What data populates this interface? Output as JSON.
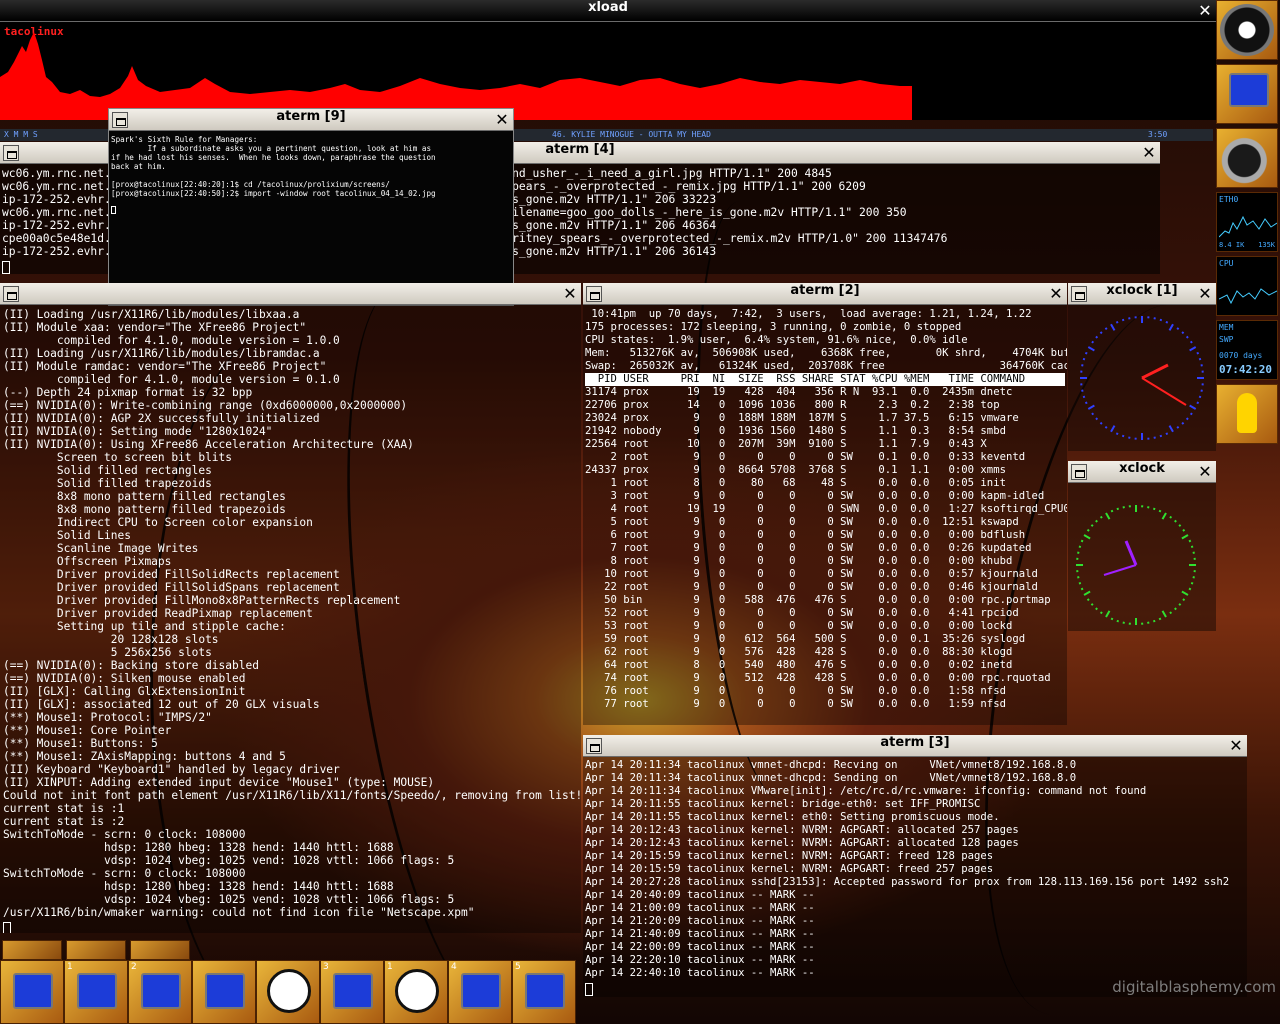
{
  "xload": {
    "title": "xload",
    "host": "tacolinux"
  },
  "xmms": {
    "logo": "X M M S",
    "track": "46. KYLIE MINOGUE - OUTTA MY HEAD",
    "time": "3:50"
  },
  "aterm9": {
    "title": "aterm  [9]",
    "lines": [
      "Spark's Sixth Rule for Managers:",
      "        If a subordinate asks you a pertinent question, look at him as",
      "if he had lost his senses.  When he looks down, paraphrase the question",
      "back at him.",
      "",
      "[prox@tacolinux[22:40:20]:1$ cd /tacolinux/prolixium/screens/",
      "[prox@tacolinux[22:40:50]:2$ import -window root tacolinux_04_14_02.jpg"
    ]
  },
  "aterm4": {
    "title": "aterm  [4]",
    "lines": [
      "wc06.ym.rnc.net.ca                                                p_diddy_and_usher_-_i_need_a_girl.jpg HTTP/1.1\" 200 4845",
      "wc06.ym.rnc.net.ca                                                britney_spears_-_overprotected_-_remix.jpg HTTP/1.1\" 200 6209",
      "ip-172-252.evhr.ne                                                _-_here_is_gone.m2v HTTP/1.1\" 206 33223",
      "wc06.ym.rnc.net.ca                                                deo.php?filename=goo_goo_dolls_-_here_is_gone.m2v HTTP/1.1\" 200 350",
      "ip-172-252.evhr.ne                                                _-_here_is_gone.m2v HTTP/1.1\" 206 46364",
      "cpe00a0c5e48e1d.cp                                                /videos/britney_spears_-_overprotected_-_remix.m2v HTTP/1.0\" 200 11347476",
      "ip-172-252.evhr.ne                                                _-_here_is_gone.m2v HTTP/1.1\" 206 36143"
    ]
  },
  "atermLeft": {
    "lines": [
      "(II) Loading /usr/X11R6/lib/modules/libxaa.a",
      "(II) Module xaa: vendor=\"The XFree86 Project\"",
      "        compiled for 4.1.0, module version = 1.0.0",
      "(II) Loading /usr/X11R6/lib/modules/libramdac.a",
      "(II) Module ramdac: vendor=\"The XFree86 Project\"",
      "        compiled for 4.1.0, module version = 0.1.0",
      "(--) Depth 24 pixmap format is 32 bpp",
      "(==) NVIDIA(0): Write-combining range (0xd6000000,0x2000000)",
      "(II) NVIDIA(0): AGP 2X successfully initialized",
      "(II) NVIDIA(0): Setting mode \"1280x1024\"",
      "(II) NVIDIA(0): Using XFree86 Acceleration Architecture (XAA)",
      "        Screen to screen bit blits",
      "        Solid filled rectangles",
      "        Solid filled trapezoids",
      "        8x8 mono pattern filled rectangles",
      "        8x8 mono pattern filled trapezoids",
      "        Indirect CPU to Screen color expansion",
      "        Solid Lines",
      "        Scanline Image Writes",
      "        Offscreen Pixmaps",
      "        Driver provided FillSolidRects replacement",
      "        Driver provided FillSolidSpans replacement",
      "        Driver provided FillMono8x8PatternRects replacement",
      "        Driver provided ReadPixmap replacement",
      "        Setting up tile and stipple cache:",
      "                20 128x128 slots",
      "                5 256x256 slots",
      "(==) NVIDIA(0): Backing store disabled",
      "(==) NVIDIA(0): Silken mouse enabled",
      "(II) [GLX]: Calling GlxExtensionInit",
      "(II) [GLX]: associated 12 out of 20 GLX visuals",
      "(**) Mouse1: Protocol: \"IMPS/2\"",
      "(**) Mouse1: Core Pointer",
      "(**) Mouse1: Buttons: 5",
      "(**) Mouse1: ZAxisMapping: buttons 4 and 5",
      "(II) Keyboard \"Keyboard1\" handled by legacy driver",
      "(II) XINPUT: Adding extended input device \"Mouse1\" (type: MOUSE)",
      "Could not init font path element /usr/X11R6/lib/X11/fonts/Speedo/, removing from list!",
      "current stat is :1",
      "current stat is :2",
      "SwitchToMode - scrn: 0 clock: 108000",
      "               hdsp: 1280 hbeg: 1328 hend: 1440 httl: 1688",
      "               vdsp: 1024 vbeg: 1025 vend: 1028 vttl: 1066 flags: 5",
      "SwitchToMode - scrn: 0 clock: 108000",
      "               hdsp: 1280 hbeg: 1328 hend: 1440 httl: 1688",
      "               vdsp: 1024 vbeg: 1025 vend: 1028 vttl: 1066 flags: 5",
      "/usr/X11R6/bin/wmaker warning: could not find icon file \"Netscape.xpm\""
    ]
  },
  "aterm2": {
    "title": "aterm  [2]",
    "header": [
      " 10:41pm  up 70 days,  7:42,  3 users,  load average: 1.21, 1.24, 1.22",
      "175 processes: 172 sleeping, 3 running, 0 zombie, 0 stopped",
      "CPU states:  1.9% user,  6.4% system, 91.6% nice,  0.0% idle",
      "Mem:   513276K av,  506908K used,    6368K free,       0K shrd,    4704K buff",
      "Swap:  265032K av,   61324K used,  203708K free                  364760K cached"
    ],
    "columns": "  PID USER     PRI  NI  SIZE  RSS SHARE STAT %CPU %MEM   TIME COMMAND",
    "rows": [
      "31174 prox      19  19   428  404   356 R N  93.1  0.0  2435m dnetc",
      "22706 prox      14   0  1096 1036   800 R     2.3  0.2   2:38 top",
      "23024 prox       9   0  188M 188M  187M S     1.7 37.5   6:15 vmware",
      "21942 nobody     9   0  1936 1560  1480 S     1.1  0.3   8:54 smbd",
      "22564 root      10   0  207M  39M  9100 S     1.1  7.9   0:43 X",
      "    2 root       9   0     0    0     0 SW    0.1  0.0   0:33 keventd",
      "24337 prox       9   0  8664 5708  3768 S     0.1  1.1   0:00 xmms",
      "    1 root       8   0    80   68    48 S     0.0  0.0   0:05 init",
      "    3 root       9   0     0    0     0 SW    0.0  0.0   0:00 kapm-idled",
      "    4 root      19  19     0    0     0 SWN   0.0  0.0   1:27 ksoftirqd_CPU0",
      "    5 root       9   0     0    0     0 SW    0.0  0.0  12:51 kswapd",
      "    6 root       9   0     0    0     0 SW    0.0  0.0   0:00 bdflush",
      "    7 root       9   0     0    0     0 SW    0.0  0.0   0:26 kupdated",
      "    8 root       9   0     0    0     0 SW    0.0  0.0   0:00 khubd",
      "   10 root       9   0     0    0     0 SW    0.0  0.0   0:57 kjournald",
      "   22 root       9   0     0    0     0 SW    0.0  0.0   0:46 kjournald",
      "   50 bin        9   0   588  476   476 S     0.0  0.0   0:00 rpc.portmap",
      "   52 root       9   0     0    0     0 SW    0.0  0.0   4:41 rpciod",
      "   53 root       9   0     0    0     0 SW    0.0  0.0   0:00 lockd",
      "   59 root       9   0   612  564   500 S     0.0  0.1  35:26 syslogd",
      "   62 root       9   0   576  428   428 S     0.0  0.0  88:30 klogd",
      "   64 root       8   0   540  480   476 S     0.0  0.0   0:02 inetd",
      "   74 root       9   0   512  428   428 S     0.0  0.0   0:00 rpc.rquotad",
      "   76 root       9   0     0    0     0 SW    0.0  0.0   1:58 nfsd",
      "   77 root       9   0     0    0     0 SW    0.0  0.0   1:59 nfsd"
    ]
  },
  "aterm3": {
    "title": "aterm  [3]",
    "lines": [
      "Apr 14 20:11:34 tacolinux vmnet-dhcpd: Recving on     VNet/vmnet8/192.168.8.0",
      "Apr 14 20:11:34 tacolinux vmnet-dhcpd: Sending on     VNet/vmnet8/192.168.8.0",
      "Apr 14 20:11:34 tacolinux VMware[init]: /etc/rc.d/rc.vmware: ifconfig: command not found",
      "Apr 14 20:11:55 tacolinux kernel: bridge-eth0: set IFF_PROMISC",
      "Apr 14 20:11:55 tacolinux kernel: eth0: Setting promiscuous mode.",
      "Apr 14 20:12:43 tacolinux kernel: NVRM: AGPGART: allocated 257 pages",
      "Apr 14 20:12:43 tacolinux kernel: NVRM: AGPGART: allocated 128 pages",
      "Apr 14 20:15:59 tacolinux kernel: NVRM: AGPGART: freed 128 pages",
      "Apr 14 20:15:59 tacolinux kernel: NVRM: AGPGART: freed 257 pages",
      "Apr 14 20:27:28 tacolinux sshd[23153]: Accepted password for prox from 128.113.169.156 port 1492 ssh2",
      "Apr 14 20:40:09 tacolinux -- MARK --",
      "Apr 14 21:00:09 tacolinux -- MARK --",
      "Apr 14 21:20:09 tacolinux -- MARK --",
      "Apr 14 21:40:09 tacolinux -- MARK --",
      "Apr 14 22:00:09 tacolinux -- MARK --",
      "Apr 14 22:20:10 tacolinux -- MARK --",
      "Apr 14 22:40:10 tacolinux -- MARK --"
    ]
  },
  "xclock1": {
    "title": "xclock  [1]"
  },
  "xclock2": {
    "title": "xclock"
  },
  "dock": {
    "eth_label": "ETH0",
    "eth_rx": "8.4 IK",
    "eth_tx": "135K",
    "cpu_label": "CPU",
    "mem_label": "MEM",
    "swp_label": "SWP",
    "uptime": "0070 days",
    "time": "07:42:20"
  },
  "workspaces": [
    "",
    "1",
    "2",
    "",
    "",
    "3",
    "1",
    "4",
    "5"
  ],
  "watermark": "digitalblasphemy.com"
}
